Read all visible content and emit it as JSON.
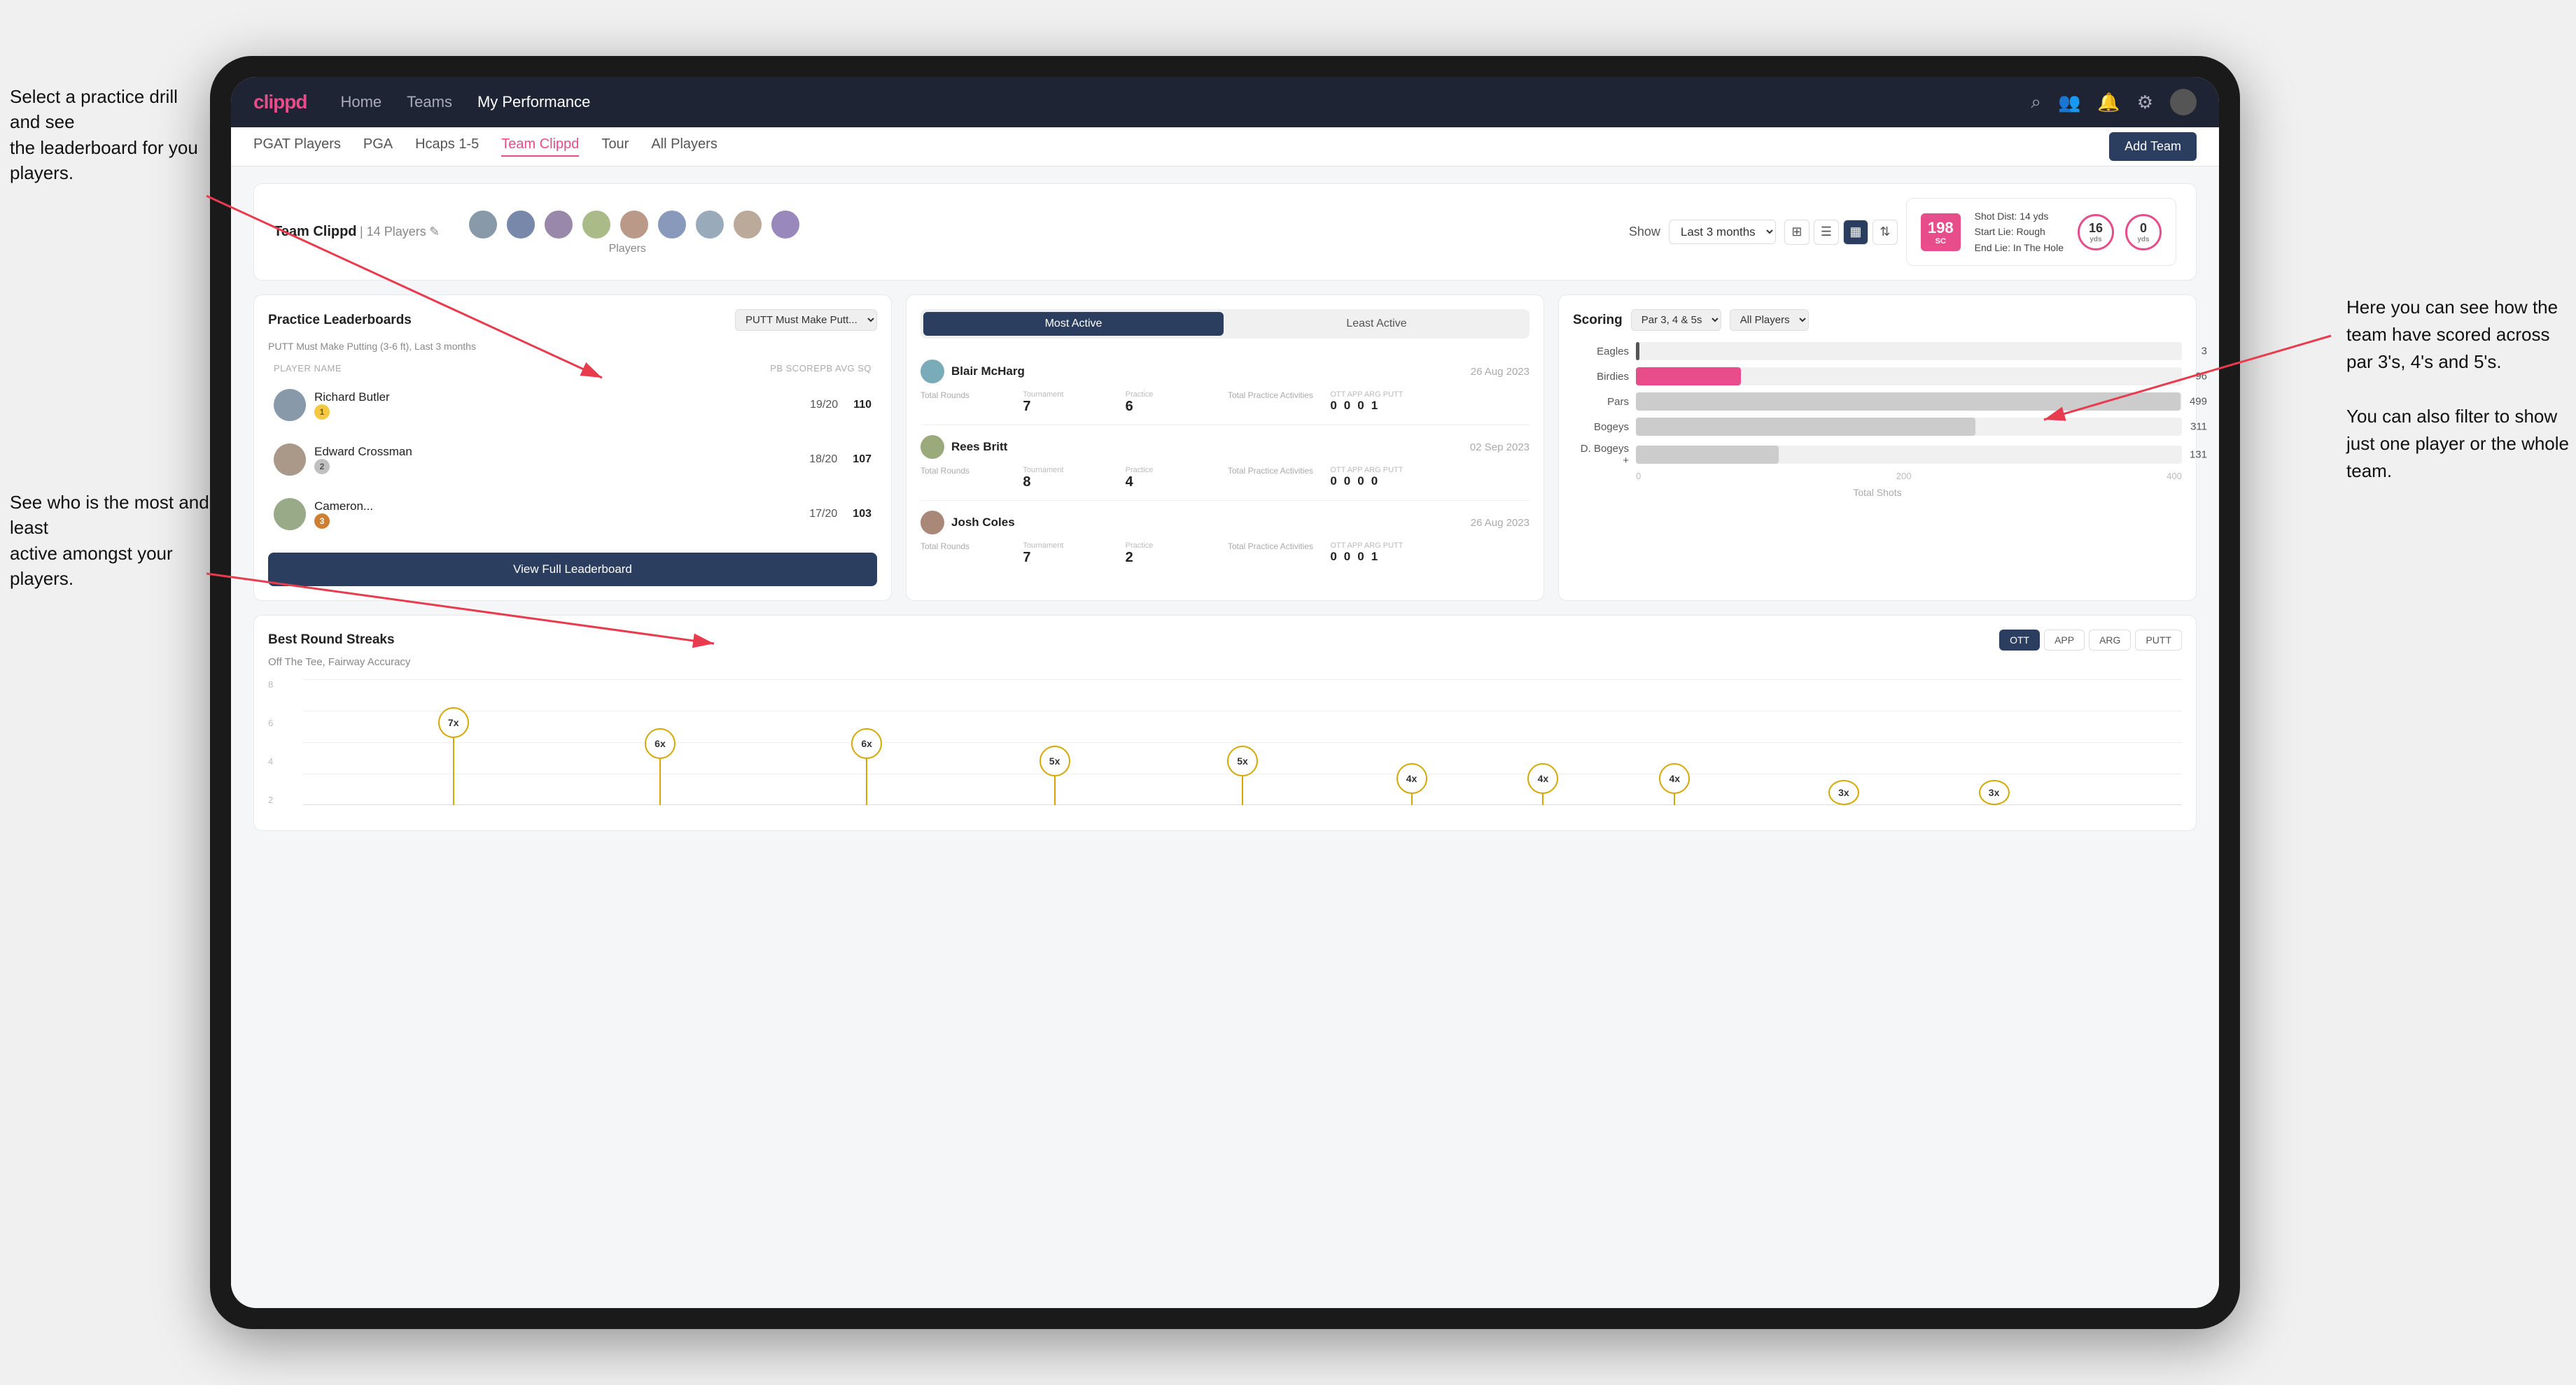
{
  "annotations": {
    "top_left": "Select a practice drill and see\nthe leaderboard for you players.",
    "bottom_left": "See who is the most and least\nactive amongst your players.",
    "top_right": "Here you can see how the\nteam have scored across\npar 3's, 4's and 5's.\n\nYou can also filter to show\njust one player or the whole\nteam."
  },
  "nav": {
    "logo": "clippd",
    "links": [
      "Home",
      "Teams",
      "My Performance"
    ],
    "active_link": "Teams"
  },
  "subnav": {
    "links": [
      "PGAT Players",
      "PGA",
      "Hcaps 1-5",
      "Team Clippd",
      "Tour",
      "All Players"
    ],
    "active": "Team Clippd",
    "add_team": "Add Team"
  },
  "team": {
    "name": "Team Clippd",
    "player_count": "14 Players",
    "show_label": "Show",
    "show_value": "Last 3 months"
  },
  "shot_card": {
    "badge": "198",
    "badge_sub": "SC",
    "info_line1": "Shot Dist: 14 yds",
    "info_line2": "Start Lie: Rough",
    "info_line3": "End Lie: In The Hole",
    "circle1_value": "16",
    "circle1_label": "yds",
    "circle2_value": "0",
    "circle2_label": "yds"
  },
  "leaderboard": {
    "title": "Practice Leaderboards",
    "drill": "PUTT Must Make Putt...",
    "subtitle": "PUTT Must Make Putting (3-6 ft), Last 3 months",
    "col_player": "PLAYER NAME",
    "col_score": "PB SCORE",
    "col_avg": "PB AVG SQ",
    "players": [
      {
        "name": "Richard Butler",
        "score": "19/20",
        "avg": "110",
        "medal": "gold",
        "rank": 1
      },
      {
        "name": "Edward Crossman",
        "score": "18/20",
        "avg": "107",
        "medal": "silver",
        "rank": 2
      },
      {
        "name": "Cameron...",
        "score": "17/20",
        "avg": "103",
        "medal": "bronze",
        "rank": 3
      }
    ],
    "view_btn": "View Full Leaderboard"
  },
  "active": {
    "tab_most": "Most Active",
    "tab_least": "Least Active",
    "active_tab": "Most Active",
    "players": [
      {
        "name": "Blair McHarg",
        "date": "26 Aug 2023",
        "total_rounds_label": "Total Rounds",
        "tournament_label": "Tournament",
        "practice_label": "Practice",
        "tournament_val": "7",
        "practice_val": "6",
        "total_practice_label": "Total Practice Activities",
        "ott_label": "OTT",
        "app_label": "APP",
        "arg_label": "ARG",
        "putt_label": "PUTT",
        "ott_val": "0",
        "app_val": "0",
        "arg_val": "0",
        "putt_val": "1"
      },
      {
        "name": "Rees Britt",
        "date": "02 Sep 2023",
        "tournament_val": "8",
        "practice_val": "4",
        "ott_val": "0",
        "app_val": "0",
        "arg_val": "0",
        "putt_val": "0"
      },
      {
        "name": "Josh Coles",
        "date": "26 Aug 2023",
        "tournament_val": "7",
        "practice_val": "2",
        "ott_val": "0",
        "app_val": "0",
        "arg_val": "0",
        "putt_val": "1"
      }
    ]
  },
  "scoring": {
    "title": "Scoring",
    "filter": "Par 3, 4 & 5s",
    "player_filter": "All Players",
    "bars": [
      {
        "label": "Eagles",
        "value": 3,
        "max": 500,
        "color": "#555"
      },
      {
        "label": "Birdies",
        "value": 96,
        "max": 500,
        "color": "#e74c8b"
      },
      {
        "label": "Pars",
        "value": 499,
        "max": 500,
        "color": "#bbb"
      },
      {
        "label": "Bogeys",
        "value": 311,
        "max": 500,
        "color": "#bbb"
      },
      {
        "label": "D. Bogeys +",
        "value": 131,
        "max": 500,
        "color": "#bbb"
      }
    ],
    "axis_labels": [
      "0",
      "200",
      "400"
    ],
    "total_shots": "Total Shots"
  },
  "streaks": {
    "title": "Best Round Streaks",
    "subtitle": "Off The Tee, Fairway Accuracy",
    "filter_btns": [
      "OTT",
      "APP",
      "ARG",
      "PUTT"
    ],
    "active_filter": "OTT",
    "pins": [
      {
        "label": "7x",
        "x_pct": 8
      },
      {
        "label": "6x",
        "x_pct": 19
      },
      {
        "label": "6x",
        "x_pct": 30
      },
      {
        "label": "5x",
        "x_pct": 41
      },
      {
        "label": "5x",
        "x_pct": 52
      },
      {
        "label": "4x",
        "x_pct": 60
      },
      {
        "label": "4x",
        "x_pct": 66
      },
      {
        "label": "4x",
        "x_pct": 72
      },
      {
        "label": "3x",
        "x_pct": 82
      },
      {
        "label": "3x",
        "x_pct": 90
      }
    ]
  }
}
